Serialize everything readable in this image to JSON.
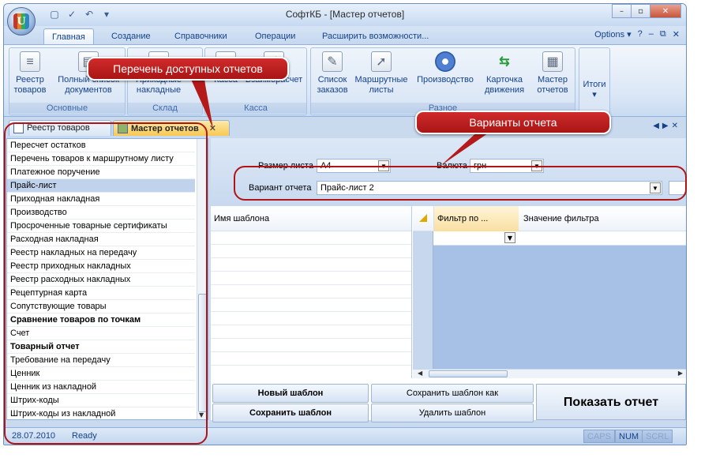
{
  "app": {
    "title": "СофтКБ - [Мастер отчетов]",
    "logo_letter": "U"
  },
  "quick_access": [
    "new-doc-icon",
    "check-icon",
    "undo-icon",
    "dropdown-icon"
  ],
  "window_buttons": {
    "minimize": "–",
    "restore": "▫",
    "close": "✕"
  },
  "ribbon_tabs": [
    "Главная",
    "Создание",
    "Справочники",
    "Операции",
    "Расширить возможности..."
  ],
  "active_ribbon_tab": "Главная",
  "options": {
    "label": "Options",
    "help": "?",
    "min": "–",
    "restore": "⧉",
    "close": "✕"
  },
  "ribbon": {
    "groups": [
      {
        "name": "Основные",
        "buttons": [
          "Реестр товаров",
          "Полный список документов"
        ]
      },
      {
        "name": "Склад",
        "buttons": [
          "Приходные накладные"
        ]
      },
      {
        "name": "Касса",
        "buttons": [
          "Касса",
          "Взаиморасчет"
        ]
      },
      {
        "name": "Разное",
        "buttons": [
          "Список заказов",
          "Маршрутные листы",
          "Производство",
          "Карточка движения",
          "Мастер отчетов"
        ]
      },
      {
        "name": "",
        "buttons": [
          "Итоги"
        ]
      }
    ]
  },
  "doc_tabs": [
    {
      "label": "Реестр товаров",
      "active": false
    },
    {
      "label": "Мастер отчетов",
      "active": true
    }
  ],
  "report_list": [
    {
      "label": "Пересчет остатков",
      "bold": false
    },
    {
      "label": "Перечень товаров к маршрутному листу",
      "bold": false
    },
    {
      "label": "Платежное поручение",
      "bold": false
    },
    {
      "label": "Прайс-лист",
      "bold": false,
      "selected": true
    },
    {
      "label": "Приходная накладная",
      "bold": false
    },
    {
      "label": "Производство",
      "bold": false
    },
    {
      "label": "Просроченные товарные сертификаты",
      "bold": false
    },
    {
      "label": "Расходная накладная",
      "bold": false
    },
    {
      "label": "Реестр накладных на передачу",
      "bold": false
    },
    {
      "label": "Реестр приходных накладных",
      "bold": false
    },
    {
      "label": "Реестр расходных накладных",
      "bold": false
    },
    {
      "label": "Рецептурная карта",
      "bold": false
    },
    {
      "label": "Сопутствующие товары",
      "bold": false
    },
    {
      "label": "Сравнение товаров по точкам",
      "bold": true
    },
    {
      "label": "Счет",
      "bold": false
    },
    {
      "label": "Товарный отчет",
      "bold": true
    },
    {
      "label": "Требование на передачу",
      "bold": false
    },
    {
      "label": "Ценник",
      "bold": false
    },
    {
      "label": "Ценник из накладной",
      "bold": false
    },
    {
      "label": "Штрих-коды",
      "bold": false
    },
    {
      "label": "Штрих-коды из накладной",
      "bold": false
    }
  ],
  "form": {
    "page_size_label": "Размер листа",
    "page_size_value": "A4",
    "currency_label": "Валюта",
    "currency_value": "грн",
    "variant_label": "Вариант отчета",
    "variant_value": "Прайс-лист 2"
  },
  "template_grid": {
    "header": "Имя шаблона"
  },
  "filter_grid": {
    "col1": "Фильтр по ...",
    "col2": "Значение фильтра"
  },
  "buttons": {
    "new_template": "Новый шаблон",
    "save_template_as": "Сохранить шаблон как",
    "save_template": "Сохранить шаблон",
    "delete_template": "Удалить шаблон",
    "show_report": "Показать отчет"
  },
  "status": {
    "date": "28.07.2010",
    "state": "Ready",
    "caps": "CAPS",
    "num": "NUM",
    "scrl": "SCRL"
  },
  "callouts": {
    "reports_list": "Перечень доступных отчетов",
    "variants": "Варианты отчета"
  },
  "colors": {
    "accent": "#15428b",
    "callout": "#c21f1f",
    "active_tab": "#f7c852"
  }
}
